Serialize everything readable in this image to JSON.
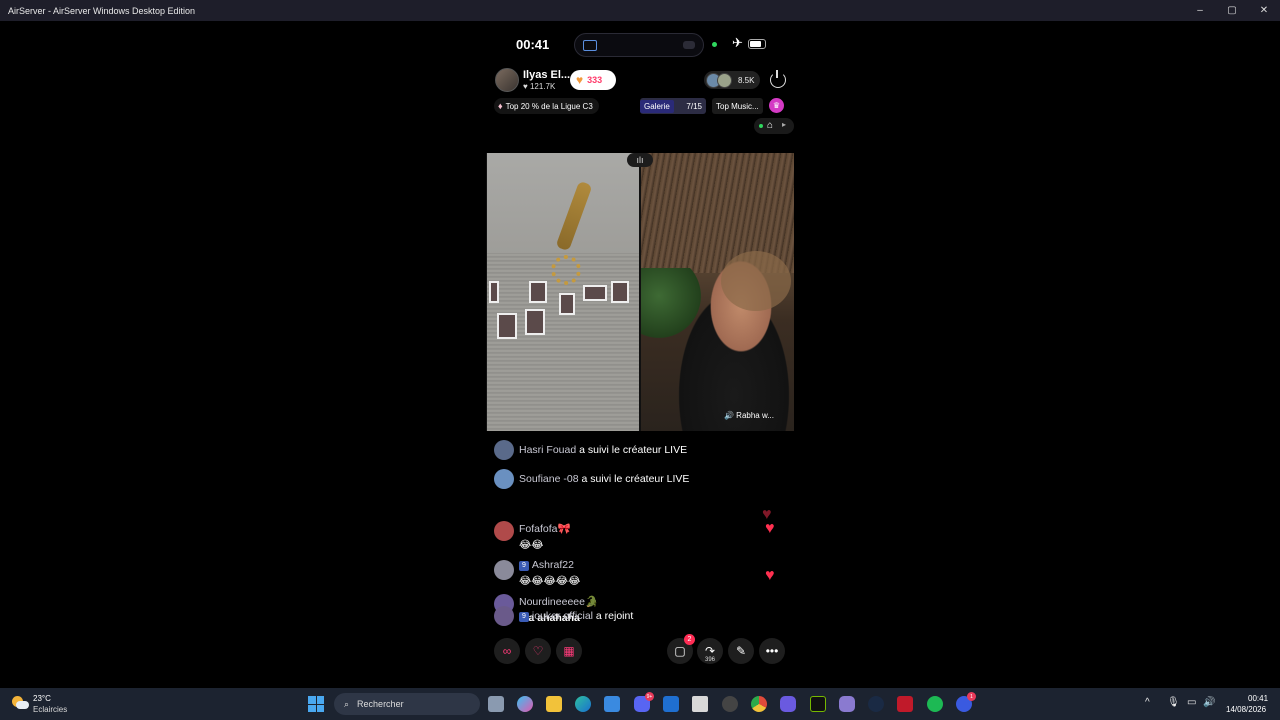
{
  "window": {
    "title": "AirServer - AirServer Windows Desktop Edition",
    "controls": [
      "–",
      "▢",
      "✕"
    ]
  },
  "phone_status": {
    "time": "00:41",
    "airplane_icon": "✈"
  },
  "host": {
    "name": "Ilyas El...",
    "likes": "♥ 121.7K",
    "gift_count": "333",
    "viewer_count": "8.5K"
  },
  "badges": {
    "rank": "Top 20 % de la Ligue C3",
    "galerie_label": "Galerie",
    "galerie_count": "7/15",
    "top_music": "Top Music...",
    "magenta_icon": "♛"
  },
  "video": {
    "guest_label": "🔊 Rabha w..."
  },
  "comments": [
    {
      "user": "Hasri Fouad",
      "action": "a suivi le créateur LIVE",
      "msg": "",
      "level": "",
      "avatar_color": "#5a6a8a"
    },
    {
      "user": "Soufiane -08",
      "action": "a suivi le créateur LIVE",
      "msg": "",
      "level": "",
      "avatar_color": "#6a90c0"
    },
    {
      "user": "Fofafofa🎀",
      "action": "",
      "msg": "😂😂",
      "level": "",
      "avatar_color": "#b04a4a"
    },
    {
      "user": "Ashraf22",
      "action": "",
      "msg": "😂😂😂😂😂",
      "level": "9",
      "avatar_color": "#8a8a9a"
    },
    {
      "user": "Nourdineeeee🐊",
      "action": "",
      "msg": "Wa ahahaha",
      "level": "",
      "avatar_color": "#6a5a9a"
    },
    {
      "user": "jouker official",
      "action": "a rejoint",
      "msg": "",
      "level": "9",
      "avatar_color": "#6a5a8a"
    }
  ],
  "bottom_bar": {
    "comment_badge": "2",
    "share_count": "396",
    "more_label": "•••"
  },
  "taskbar": {
    "temperature": "23°C",
    "condition": "Eclaircies",
    "search_placeholder": "Rechercher",
    "clock_time": "00:41",
    "clock_date": "14/08/2026",
    "discord_badge": "9+",
    "ea_badge": "1"
  },
  "colors": {
    "accent_pink": "#ff3b7a",
    "heart_red": "#ff3050",
    "taskbar_bg": "#1c2330"
  }
}
